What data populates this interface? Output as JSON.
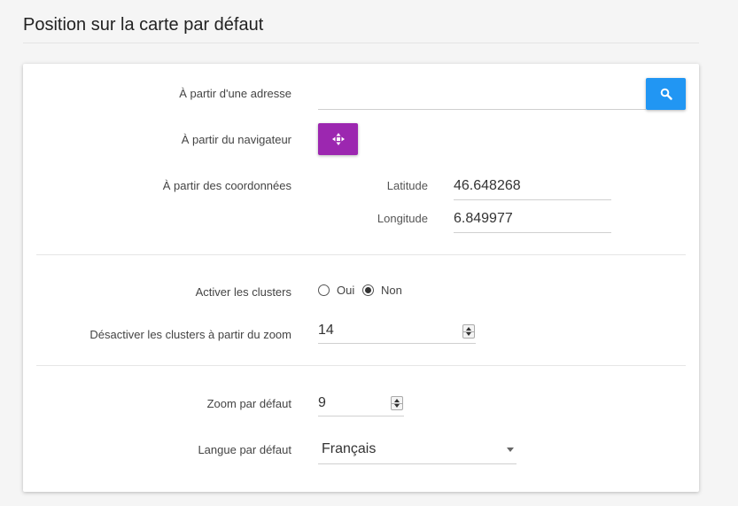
{
  "page": {
    "title": "Position sur la carte par défaut"
  },
  "address": {
    "label": "À partir d'une adresse",
    "value": "",
    "placeholder": ""
  },
  "browser": {
    "label": "À partir du navigateur"
  },
  "coordinates": {
    "label": "À partir des coordonnées",
    "latitude_label": "Latitude",
    "latitude_value": "46.648268",
    "longitude_label": "Longitude",
    "longitude_value": "6.849977"
  },
  "clusters": {
    "label": "Activer les clusters",
    "options": [
      "Oui",
      "Non"
    ],
    "selected": "Non"
  },
  "cluster_zoom": {
    "label": "Désactiver les clusters à partir du zoom",
    "value": "14"
  },
  "default_zoom": {
    "label": "Zoom par défaut",
    "value": "9"
  },
  "language": {
    "label": "Langue par défaut",
    "value": "Français"
  },
  "colors": {
    "search_button": "#2196f3",
    "locate_button": "#9c27b0"
  },
  "icons": {
    "search": "search-icon",
    "locate": "crosshair-icon",
    "select": "chevron-down-icon"
  }
}
